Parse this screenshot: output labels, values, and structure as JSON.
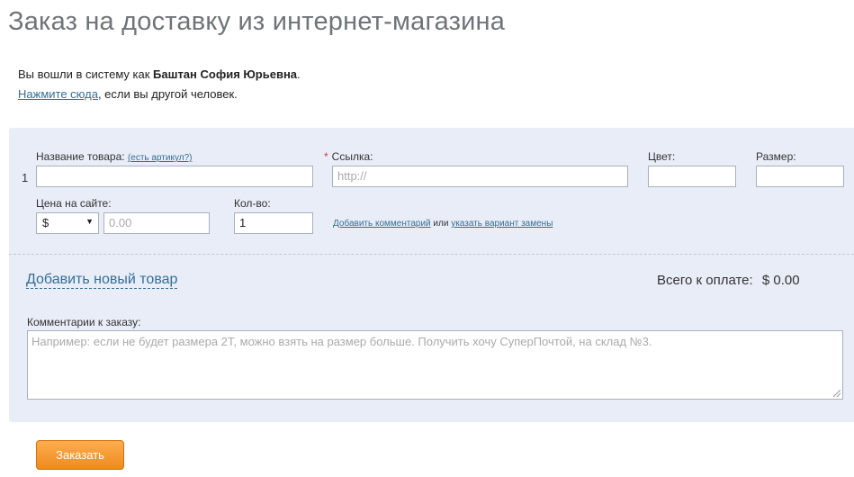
{
  "page": {
    "title": "Заказ на доставку из интернет-магазина"
  },
  "login": {
    "prefix": "Вы вошли в систему как ",
    "user_name": "Баштан София Юрьевна",
    "suffix": ".",
    "switch_link": "Нажмите сюда",
    "switch_suffix": ", если вы другой человек."
  },
  "item_row": {
    "number": "1",
    "name_label": "Название товара:",
    "article_link": "(есть артикул?)",
    "name_value": "",
    "link_required_mark": "*",
    "link_label": "Ссылка:",
    "link_placeholder": "http://",
    "color_label": "Цвет:",
    "color_value": "",
    "size_label": "Размер:",
    "size_value": "",
    "price_label": "Цена на сайте:",
    "currency_selected": "$",
    "price_placeholder": "0.00",
    "qty_label": "Кол-во:",
    "qty_value": "1",
    "add_comment_link": "Добавить комментарий",
    "or_text": " или ",
    "replacement_link": "указать вариант замены"
  },
  "order": {
    "add_item_link": "Добавить новый товар",
    "total_label": "Всего к оплате:",
    "total_value": "$ 0.00",
    "comment_label": "Комментарии к заказу:",
    "comment_placeholder": "Например: если не будет размера 2Т, можно взять на размер больше. Получить хочу СуперПочтой, на склад №3.",
    "submit_label": "Заказать"
  },
  "colors": {
    "panel_bg": "#e9edf8",
    "link": "#336e96",
    "button_orange": "#f08a1d",
    "required_mark": "#dd3333"
  }
}
